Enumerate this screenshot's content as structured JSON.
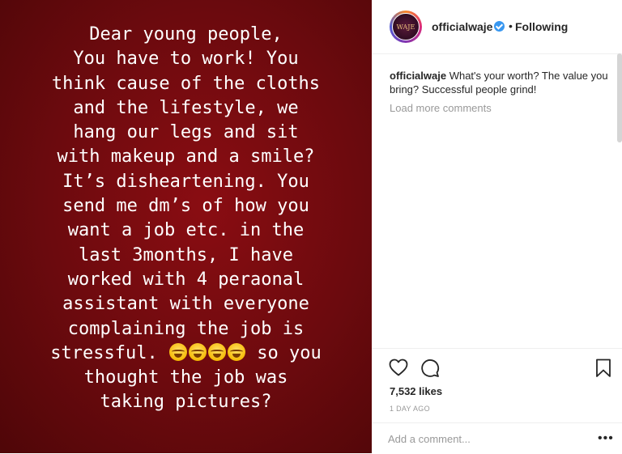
{
  "post": {
    "text_lines": [
      "Dear young people,",
      "",
      "You have to work! You",
      "think cause of the cloths",
      "and the lifestyle, we",
      "hang our legs and sit",
      "with makeup and a smile?",
      "It’s disheartening. You",
      "send me dm’s of how you",
      "want a job etc. in the",
      "last 3months, I have",
      "worked with 4 peraonal",
      "assistant with everyone",
      "complaining the job is"
    ],
    "line_stressful": "stressful.",
    "line_so_you": "so you",
    "tail_lines": [
      "thought the job was",
      "taking pictures?"
    ]
  },
  "header": {
    "avatar_text": "WAJE",
    "username": "officialwaje",
    "dot": "•",
    "follow_label": "Following"
  },
  "caption": {
    "username": "officialwaje",
    "text": "What's your worth? The value you bring? Successful people grind!"
  },
  "load_more": "Load more comments",
  "likes": "7,532 likes",
  "timestamp": "1 DAY AGO",
  "comment": {
    "placeholder": "Add a comment...",
    "more": "•••"
  },
  "icons": [
    "heart-icon",
    "comment-icon",
    "bookmark-icon",
    "more-icon",
    "verified-badge-icon",
    "laughing-emoji-icon"
  ],
  "colors": {
    "post_background": "#6b0a0e",
    "verified": "#3897f0",
    "text_dark": "#262626",
    "text_muted": "#999999"
  }
}
